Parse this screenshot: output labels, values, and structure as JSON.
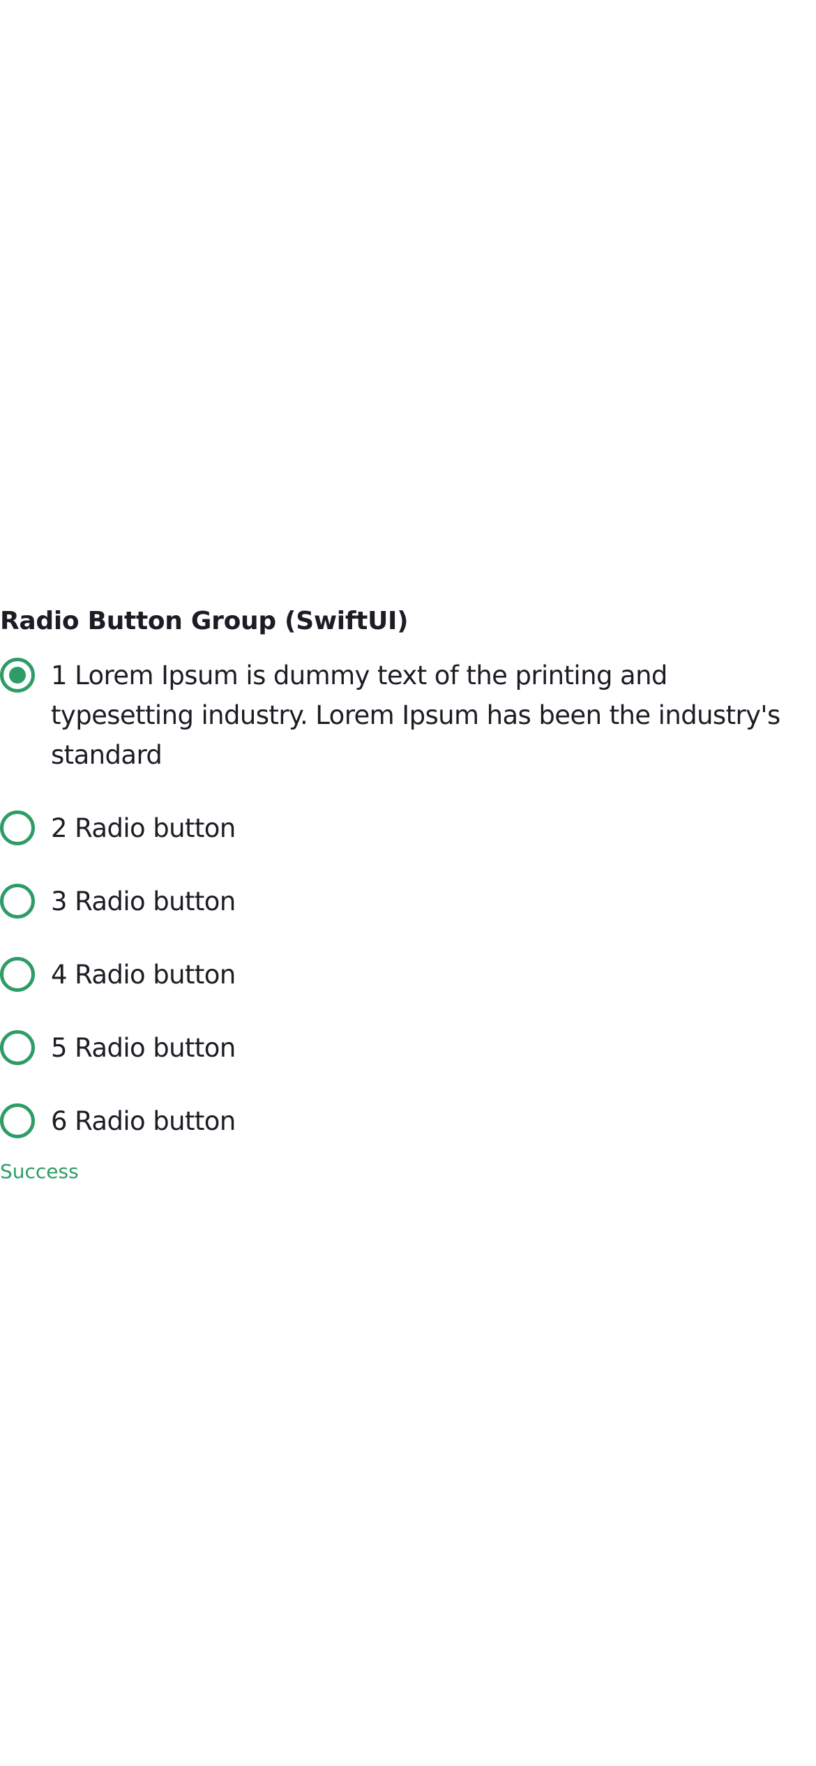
{
  "group": {
    "title": "Radio Button Group (SwiftUI)",
    "options": [
      {
        "label": "1 Lorem Ipsum is dummy text of the printing and typesetting industry. Lorem Ipsum has been the industry's standard",
        "selected": true
      },
      {
        "label": "2 Radio button",
        "selected": false
      },
      {
        "label": "3 Radio button",
        "selected": false
      },
      {
        "label": "4 Radio button",
        "selected": false
      },
      {
        "label": "5 Radio button",
        "selected": false
      },
      {
        "label": "6 Radio button",
        "selected": false
      }
    ],
    "status": "Success",
    "colors": {
      "accent": "#2e9c66",
      "text": "#1c1c24",
      "background": "#ffffff"
    }
  }
}
